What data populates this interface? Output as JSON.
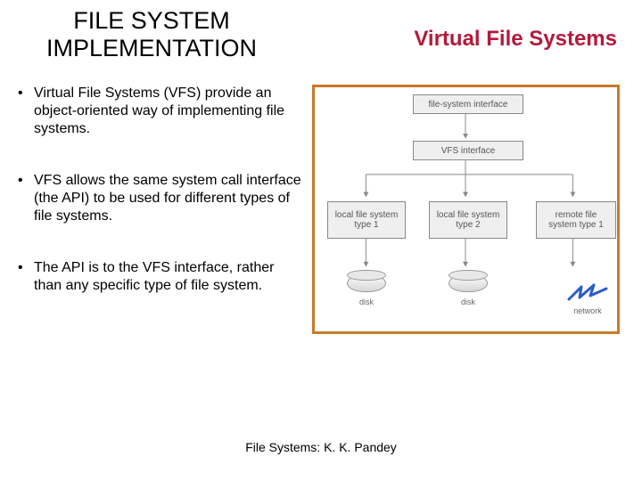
{
  "header": {
    "title_left_line1": "FILE SYSTEM",
    "title_left_line2": "IMPLEMENTATION",
    "title_right": "Virtual File Systems"
  },
  "bullets": [
    "Virtual File Systems (VFS) provide an object-oriented way of implementing file systems.",
    "VFS allows the same system call interface (the API) to be used for different types of file systems.",
    "The API is to the VFS interface, rather than any specific type of file system."
  ],
  "diagram": {
    "top_box": "file-system interface",
    "vfs_box": "VFS interface",
    "leaf1": "local file system type 1",
    "leaf2": "local file system type 2",
    "leaf3": "remote file system type 1",
    "disk_label": "disk",
    "network_label": "network"
  },
  "footer": "File Systems: K. K. Pandey"
}
